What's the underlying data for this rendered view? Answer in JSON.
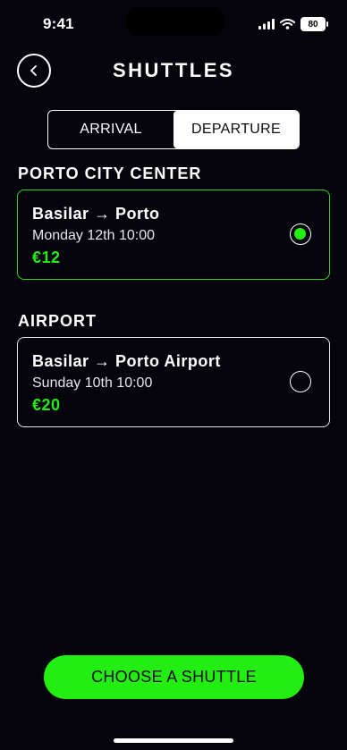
{
  "colors": {
    "background": "#05040c",
    "accent": "#22ee11",
    "selected_border": "#2fd41f",
    "text": "#ffffff"
  },
  "status_bar": {
    "time": "9:41",
    "battery": "80",
    "icons": [
      "signal-icon",
      "wifi-icon",
      "battery-icon"
    ]
  },
  "header": {
    "title": "SHUTTLES",
    "back_icon": "chevron-left-icon"
  },
  "tabs": [
    {
      "label": "ARRIVAL",
      "selected": false
    },
    {
      "label": "DEPARTURE",
      "selected": true
    }
  ],
  "sections": [
    {
      "title": "PORTO CITY CENTER",
      "option": {
        "route": "Basilar → Porto",
        "date": "Monday 12th 10:00",
        "price": "€12",
        "selected": true
      }
    },
    {
      "title": "AIRPORT",
      "option": {
        "route": "Basilar → Porto Airport",
        "date": "Sunday 10th 10:00",
        "price": "€20",
        "selected": false
      }
    }
  ],
  "cta": {
    "label": "CHOOSE A SHUTTLE"
  }
}
